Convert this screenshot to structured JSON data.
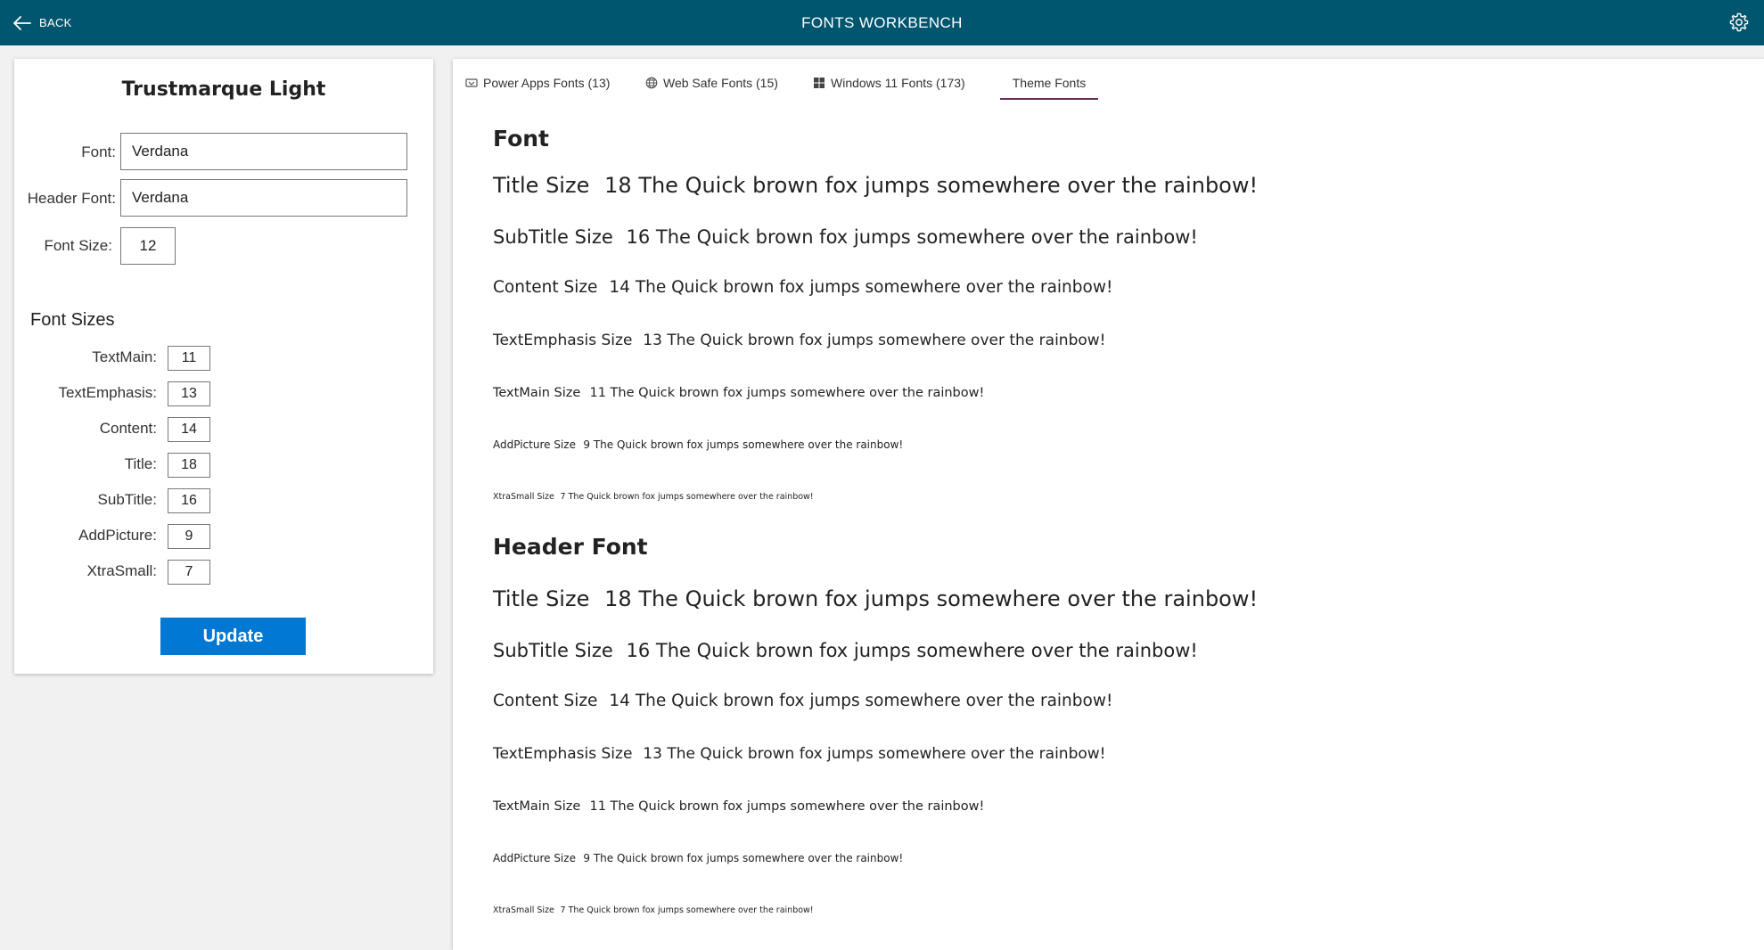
{
  "header": {
    "back_label": "BACK",
    "title": "FONTS WORKBENCH",
    "color": "#00566f"
  },
  "left": {
    "theme_name": "Trustmarque Light",
    "font_label": "Font:",
    "font_value": "Verdana",
    "header_font_label": "Header Font:",
    "header_font_value": "Verdana",
    "font_size_label": "Font Size:",
    "font_size_value": "12",
    "sizes_title": "Font Sizes",
    "sizes": [
      {
        "label": "TextMain:",
        "value": "11"
      },
      {
        "label": "TextEmphasis:",
        "value": "13"
      },
      {
        "label": "Content:",
        "value": "14"
      },
      {
        "label": "Title:",
        "value": "18"
      },
      {
        "label": "SubTitle:",
        "value": "16"
      },
      {
        "label": "AddPicture:",
        "value": "9"
      },
      {
        "label": "XtraSmall:",
        "value": "7"
      }
    ],
    "update_label": "Update",
    "accent": "#0078d4"
  },
  "tabs": [
    {
      "label": "Power Apps Fonts (13)",
      "icon": "powerapps-icon"
    },
    {
      "label": "Web Safe Fonts (15)",
      "icon": "globe-icon"
    },
    {
      "label": "Windows 11 Fonts (173)",
      "icon": "windows-icon"
    },
    {
      "label": "Theme Fonts",
      "icon": "",
      "active": true
    }
  ],
  "groups": [
    {
      "title": "Font",
      "samples": [
        {
          "label": "Title Size",
          "size": "18",
          "text": "The Quick brown fox jumps somewhere over the rainbow!"
        },
        {
          "label": "SubTitle Size",
          "size": "16",
          "text": "The Quick brown fox jumps somewhere over the rainbow!"
        },
        {
          "label": "Content Size",
          "size": "14",
          "text": "The Quick brown fox jumps somewhere over the rainbow!"
        },
        {
          "label": "TextEmphasis Size",
          "size": "13",
          "text": "The Quick brown fox jumps somewhere over the rainbow!"
        },
        {
          "label": "TextMain Size",
          "size": "11",
          "text": "The Quick brown fox jumps somewhere over the rainbow!"
        },
        {
          "label": "AddPicture Size",
          "size": "9",
          "text": "The Quick brown fox jumps somewhere over the rainbow!"
        },
        {
          "label": "XtraSmall Size",
          "size": "7",
          "text": "The Quick brown fox jumps somewhere over the rainbow!"
        }
      ]
    },
    {
      "title": "Header Font",
      "samples": [
        {
          "label": "Title Size",
          "size": "18",
          "text": "The Quick brown fox jumps somewhere over the rainbow!"
        },
        {
          "label": "SubTitle Size",
          "size": "16",
          "text": "The Quick brown fox jumps somewhere over the rainbow!"
        },
        {
          "label": "Content Size",
          "size": "14",
          "text": "The Quick brown fox jumps somewhere over the rainbow!"
        },
        {
          "label": "TextEmphasis Size",
          "size": "13",
          "text": "The Quick brown fox jumps somewhere over the rainbow!"
        },
        {
          "label": "TextMain Size",
          "size": "11",
          "text": "The Quick brown fox jumps somewhere over the rainbow!"
        },
        {
          "label": "AddPicture Size",
          "size": "9",
          "text": "The Quick brown fox jumps somewhere over the rainbow!"
        },
        {
          "label": "XtraSmall Size",
          "size": "7",
          "text": "The Quick brown fox jumps somewhere over the rainbow!"
        }
      ]
    }
  ]
}
